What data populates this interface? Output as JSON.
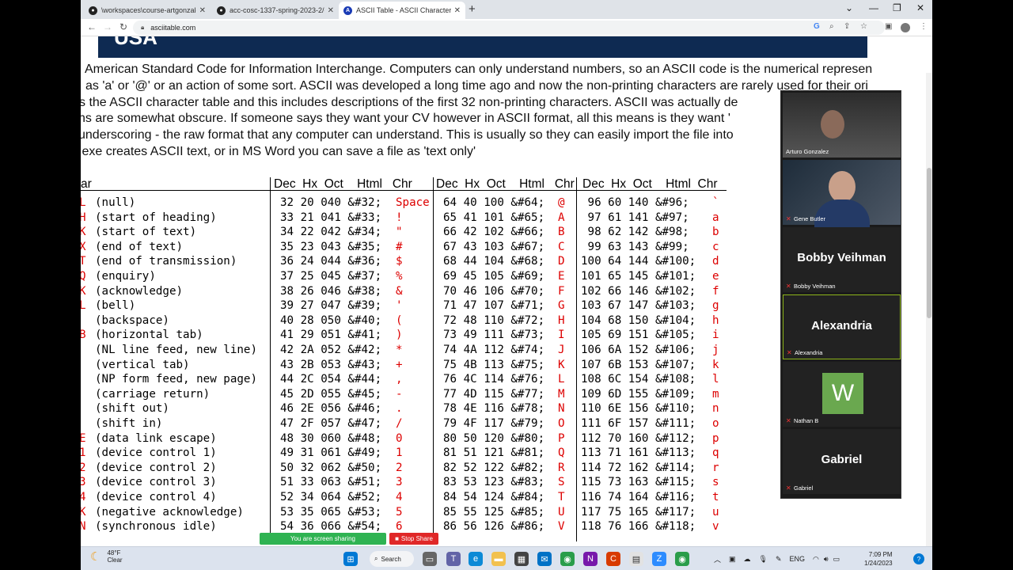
{
  "browser": {
    "tabs": [
      {
        "title": "\\workspaces\\course-artgonzalez",
        "active": false
      },
      {
        "title": "acc-cosc-1337-spring-2023-2/co",
        "active": false
      },
      {
        "title": "ASCII Table - ASCII Character Co",
        "active": true
      }
    ],
    "new_tab": "+",
    "url": "asciitable.com"
  },
  "page": {
    "banner_text": "USA",
    "intro_lines": [
      "American Standard Code for Information Interchange. Computers can only understand numbers, so an ASCII code is the numerical represen",
      "as 'a' or '@' or an action of some sort. ASCII was developed a long time ago and now the non-printing characters are rarely used for their ori",
      "s the ASCII character table and this includes descriptions of the first 32 non-printing characters. ASCII was actually de",
      "ns are somewhat obscure. If someone says they want your CV however in ASCII format, all this means is they want '",
      "underscoring - the raw format that any computer can understand. This is usually so they can easily import the file into",
      ".exe creates ASCII text, or in MS Word you can save a file as 'text only'"
    ],
    "table": {
      "headers": [
        "ar",
        "Dec  Hx  Oct    Html   Chr",
        "Dec  Hx  Oct    Html   Chr",
        "Dec  Hx  Oct    Html  Chr"
      ],
      "rows": [
        {
          "c0": "L",
          "d0": "(null)",
          "a": "32 20 040 &#32;",
          "ac": "Space",
          "b": "64 40 100 &#64;",
          "bc": "@",
          "c": " 96 60 140 &#96;",
          "cc": "`"
        },
        {
          "c0": "H",
          "d0": "(start of heading)",
          "a": "33 21 041 &#33;",
          "ac": "!",
          "b": "65 41 101 &#65;",
          "bc": "A",
          "c": " 97 61 141 &#97;",
          "cc": "a"
        },
        {
          "c0": "K",
          "d0": "(start of text)",
          "a": "34 22 042 &#34;",
          "ac": "\"",
          "b": "66 42 102 &#66;",
          "bc": "B",
          "c": " 98 62 142 &#98;",
          "cc": "b"
        },
        {
          "c0": "X",
          "d0": "(end of text)",
          "a": "35 23 043 &#35;",
          "ac": "#",
          "b": "67 43 103 &#67;",
          "bc": "C",
          "c": " 99 63 143 &#99;",
          "cc": "c"
        },
        {
          "c0": "T",
          "d0": "(end of transmission)",
          "a": "36 24 044 &#36;",
          "ac": "$",
          "b": "68 44 104 &#68;",
          "bc": "D",
          "c": "100 64 144 &#100;",
          "cc": "d"
        },
        {
          "c0": "Q",
          "d0": "(enquiry)",
          "a": "37 25 045 &#37;",
          "ac": "%",
          "b": "69 45 105 &#69;",
          "bc": "E",
          "c": "101 65 145 &#101;",
          "cc": "e"
        },
        {
          "c0": "K",
          "d0": "(acknowledge)",
          "a": "38 26 046 &#38;",
          "ac": "&",
          "b": "70 46 106 &#70;",
          "bc": "F",
          "c": "102 66 146 &#102;",
          "cc": "f"
        },
        {
          "c0": "L",
          "d0": "(bell)",
          "a": "39 27 047 &#39;",
          "ac": "'",
          "b": "71 47 107 &#71;",
          "bc": "G",
          "c": "103 67 147 &#103;",
          "cc": "g"
        },
        {
          "c0": "",
          "d0": "(backspace)",
          "a": "40 28 050 &#40;",
          "ac": "(",
          "b": "72 48 110 &#72;",
          "bc": "H",
          "c": "104 68 150 &#104;",
          "cc": "h"
        },
        {
          "c0": "B",
          "d0": "(horizontal tab)",
          "a": "41 29 051 &#41;",
          "ac": ")",
          "b": "73 49 111 &#73;",
          "bc": "I",
          "c": "105 69 151 &#105;",
          "cc": "i"
        },
        {
          "c0": "",
          "d0": "(NL line feed, new line)",
          "a": "42 2A 052 &#42;",
          "ac": "*",
          "b": "74 4A 112 &#74;",
          "bc": "J",
          "c": "106 6A 152 &#106;",
          "cc": "j"
        },
        {
          "c0": "",
          "d0": "(vertical tab)",
          "a": "43 2B 053 &#43;",
          "ac": "+",
          "b": "75 4B 113 &#75;",
          "bc": "K",
          "c": "107 6B 153 &#107;",
          "cc": "k"
        },
        {
          "c0": "",
          "d0": "(NP form feed, new page)",
          "a": "44 2C 054 &#44;",
          "ac": ",",
          "b": "76 4C 114 &#76;",
          "bc": "L",
          "c": "108 6C 154 &#108;",
          "cc": "l"
        },
        {
          "c0": "",
          "d0": "(carriage return)",
          "a": "45 2D 055 &#45;",
          "ac": "-",
          "b": "77 4D 115 &#77;",
          "bc": "M",
          "c": "109 6D 155 &#109;",
          "cc": "m"
        },
        {
          "c0": "",
          "d0": "(shift out)",
          "a": "46 2E 056 &#46;",
          "ac": ".",
          "b": "78 4E 116 &#78;",
          "bc": "N",
          "c": "110 6E 156 &#110;",
          "cc": "n"
        },
        {
          "c0": "",
          "d0": "(shift in)",
          "a": "47 2F 057 &#47;",
          "ac": "/",
          "b": "79 4F 117 &#79;",
          "bc": "O",
          "c": "111 6F 157 &#111;",
          "cc": "o"
        },
        {
          "c0": "E",
          "d0": "(data link escape)",
          "a": "48 30 060 &#48;",
          "ac": "0",
          "b": "80 50 120 &#80;",
          "bc": "P",
          "c": "112 70 160 &#112;",
          "cc": "p"
        },
        {
          "c0": "1",
          "d0": "(device control 1)",
          "a": "49 31 061 &#49;",
          "ac": "1",
          "b": "81 51 121 &#81;",
          "bc": "Q",
          "c": "113 71 161 &#113;",
          "cc": "q"
        },
        {
          "c0": "2",
          "d0": "(device control 2)",
          "a": "50 32 062 &#50;",
          "ac": "2",
          "b": "82 52 122 &#82;",
          "bc": "R",
          "c": "114 72 162 &#114;",
          "cc": "r"
        },
        {
          "c0": "3",
          "d0": "(device control 3)",
          "a": "51 33 063 &#51;",
          "ac": "3",
          "b": "83 53 123 &#83;",
          "bc": "S",
          "c": "115 73 163 &#115;",
          "cc": "s"
        },
        {
          "c0": "4",
          "d0": "(device control 4)",
          "a": "52 34 064 &#52;",
          "ac": "4",
          "b": "84 54 124 &#84;",
          "bc": "T",
          "c": "116 74 164 &#116;",
          "cc": "t"
        },
        {
          "c0": "K",
          "d0": "(negative acknowledge)",
          "a": "53 35 065 &#53;",
          "ac": "5",
          "b": "85 55 125 &#85;",
          "bc": "U",
          "c": "117 75 165 &#117;",
          "cc": "u"
        },
        {
          "c0": "N",
          "d0": "(synchronous idle)",
          "a": "54 36 066 &#54;",
          "ac": "6",
          "b": "86 56 126 &#86;",
          "bc": "V",
          "c": "118 76 166 &#118;",
          "cc": "v"
        }
      ]
    }
  },
  "zoom": {
    "participants": [
      {
        "name": "Arturo Gonzalez",
        "type": "video"
      },
      {
        "name": "Gene Butler",
        "type": "video"
      },
      {
        "name": "Bobby Veihman",
        "display": "Bobby Veihman",
        "type": "name"
      },
      {
        "name": "Alexandria",
        "display": "Alexandria",
        "type": "name",
        "selected": true
      },
      {
        "name": "Nathan B",
        "initial": "W",
        "type": "avatar"
      },
      {
        "name": "Gabriel",
        "display": "Gabriel",
        "type": "name"
      }
    ],
    "share_status": "You are screen sharing",
    "stop_share": "Stop Share"
  },
  "taskbar": {
    "weather_temp": "48°F",
    "weather_desc": "Clear",
    "search_label": "Search",
    "lang": "ENG",
    "time": "7:09 PM",
    "date": "1/24/2023"
  },
  "colors": {
    "banner": "#0e2a52",
    "accent_red": "#dd0000",
    "zoom_green": "#2fb352",
    "stop_red": "#e02828"
  }
}
